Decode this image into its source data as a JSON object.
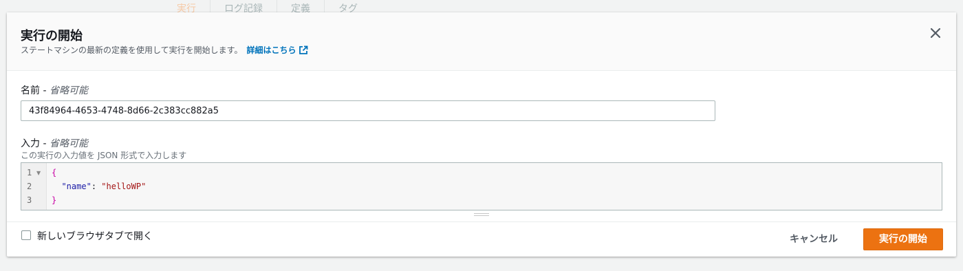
{
  "background": {
    "tabs": [
      {
        "label": "実行",
        "active": true
      },
      {
        "label": "ログ記録",
        "active": false
      },
      {
        "label": "定義",
        "active": false
      },
      {
        "label": "タグ",
        "active": false
      }
    ]
  },
  "modal": {
    "title": "実行の開始",
    "description": "ステートマシンの最新の定義を使用して実行を開始します。",
    "learn_more_link": "詳細はこちら",
    "close_icon": "close-icon"
  },
  "name_field": {
    "label": "名前 - ",
    "optional": "省略可能",
    "value": "43f84964-4653-4748-8d66-2c383cc882a5"
  },
  "input_field": {
    "label": "入力 - ",
    "optional": "省略可能",
    "hint": "この実行の入力値を JSON 形式で入力します",
    "line_numbers": [
      "1",
      "2",
      "3"
    ],
    "code": {
      "open_brace": "{",
      "key": "\"name\"",
      "colon": ": ",
      "value": "\"helloWP\"",
      "close_brace": "}"
    }
  },
  "footer": {
    "new_tab_label": "新しいブラウザタブで開く",
    "new_tab_checked": false,
    "cancel_label": "キャンセル",
    "start_label": "実行の開始"
  },
  "colors": {
    "primary": "#ec7211",
    "link": "#0073bb",
    "json_brace": "#c800a4",
    "json_key": "#1a1aa6",
    "json_string": "#a31515"
  }
}
